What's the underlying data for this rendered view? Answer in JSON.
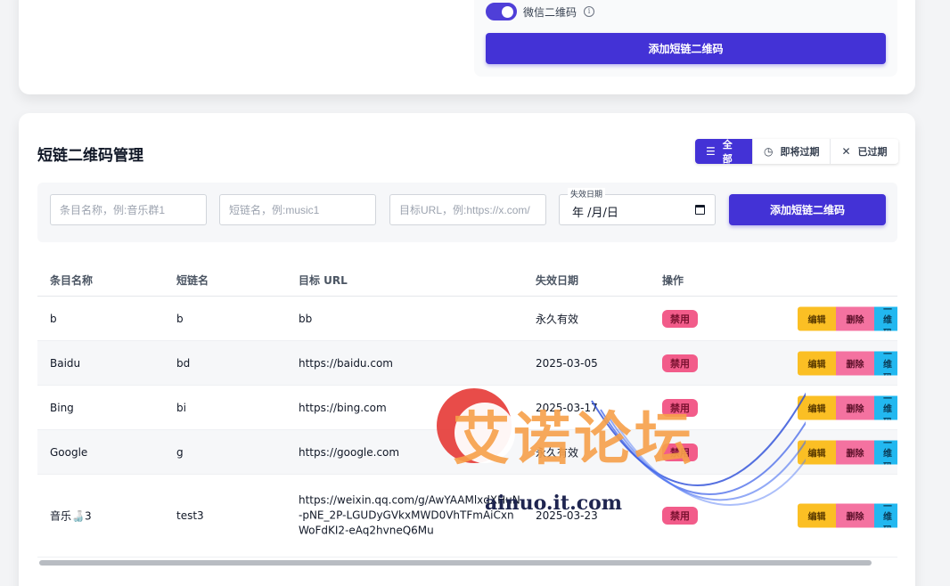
{
  "top": {
    "toggle_label": "微信二维码",
    "add_button": "添加短链二维码"
  },
  "main": {
    "title": "短链二维码管理",
    "filters": [
      {
        "label": "全部",
        "icon": "list-icon"
      },
      {
        "label": "即将过期",
        "icon": "clock-icon"
      },
      {
        "label": "已过期",
        "icon": "close-icon"
      }
    ],
    "form": {
      "name_placeholder": "条目名称，例:音乐群1",
      "short_placeholder": "短链名，例:music1",
      "url_placeholder": "目标URL，例:https://x.com/",
      "date_label": "失效日期",
      "date_value": "年 /月/日",
      "add_button": "添加短链二维码"
    },
    "table": {
      "headers": [
        "条目名称",
        "短链名",
        "目标 URL",
        "失效日期",
        "操作"
      ],
      "rows": [
        {
          "name": "b",
          "short": "b",
          "url": "bb",
          "expire": "永久有效",
          "status": "禁用"
        },
        {
          "name": "Baidu",
          "short": "bd",
          "url": "https://baidu.com",
          "expire": "2025-03-05",
          "status": "禁用"
        },
        {
          "name": "Bing",
          "short": "bi",
          "url": "https://bing.com",
          "expire": "2025-03-17",
          "status": "禁用"
        },
        {
          "name": "Google",
          "short": "g",
          "url": "https://google.com",
          "expire": "永久有效",
          "status": "禁用"
        },
        {
          "name": "音乐🍶3",
          "short": "test3",
          "url": "https://weixin.qq.com/g/AwYAAMlxdXHuN-pNE_2P-LGUDyGVkxMWD0VhTFmAiCxnWoFdKI2-eAq2hvneQ6Mu",
          "expire": "2025-03-23",
          "status": "禁用"
        }
      ],
      "actions": {
        "edit": "编辑",
        "delete": "删除",
        "qr": "二维码"
      }
    }
  },
  "watermark": {
    "title": "艾诺论坛",
    "domain": "ainuo.it.com"
  }
}
